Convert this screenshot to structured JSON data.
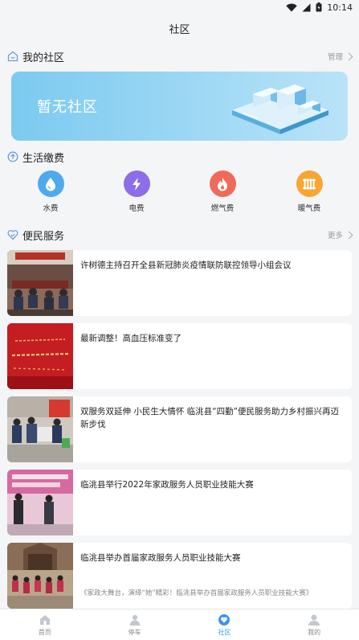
{
  "status_bar": {
    "time": "10:14"
  },
  "header": {
    "title": "社区"
  },
  "my_community": {
    "title": "我的社区",
    "action": "管理",
    "banner_text": "暂无社区"
  },
  "living_payment": {
    "title": "生活缴费",
    "items": [
      {
        "label": "水费",
        "icon": "water-drop-icon",
        "color": "#4fa9ee"
      },
      {
        "label": "电费",
        "icon": "lightning-icon",
        "color": "#8b6ee8"
      },
      {
        "label": "燃气费",
        "icon": "flame-icon",
        "color": "#f06a5a"
      },
      {
        "label": "暖气费",
        "icon": "radiator-icon",
        "color": "#f8a531"
      }
    ]
  },
  "services": {
    "title": "便民服务",
    "action": "更多",
    "news": [
      {
        "title": "许树德主持召开全县新冠肺炎疫情联防联控领导小组会议",
        "subtitle": ""
      },
      {
        "title": "最新调整！高血压标准变了",
        "subtitle": ""
      },
      {
        "title": "双服务双延伸 小民生大情怀 临洮县“四勤”便民服务助力乡村振兴再迈新步伐",
        "subtitle": ""
      },
      {
        "title": "临洮县举行2022年家政服务人员职业技能大赛",
        "subtitle": ""
      },
      {
        "title": "临洮县举办首届家政服务人员职业技能大赛",
        "subtitle": "《家政大舞台，演绎“她”精彩！临洮县举办首届家政服务人员职业技能大赛》"
      }
    ]
  },
  "tab_bar": {
    "tabs": [
      {
        "label": "首页"
      },
      {
        "label": "停车"
      },
      {
        "label": "社区"
      },
      {
        "label": "我的"
      }
    ],
    "active_color": "#3a96e8"
  }
}
